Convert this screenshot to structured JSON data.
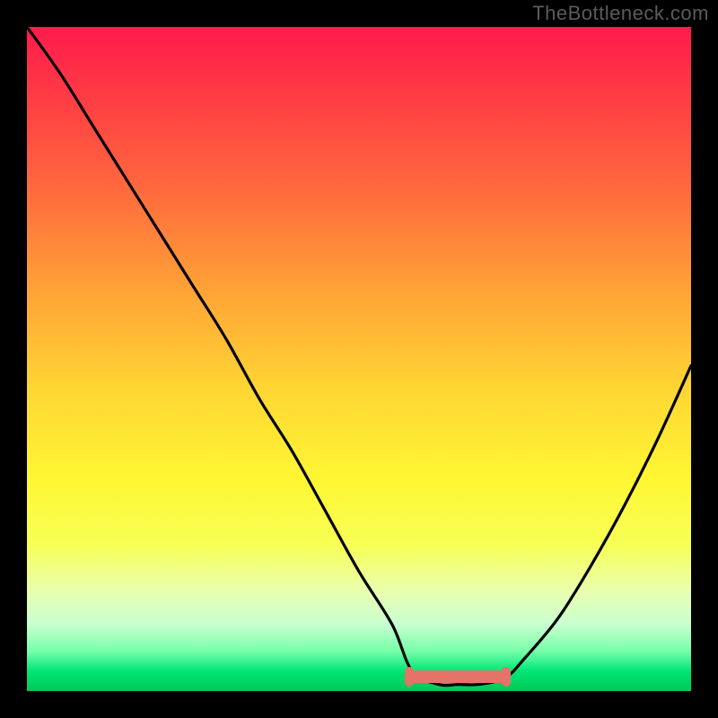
{
  "watermark": "TheBottleneck.com",
  "chart_data": {
    "type": "line",
    "title": "",
    "xlabel": "",
    "ylabel": "",
    "xlim": [
      0,
      100
    ],
    "ylim": [
      0,
      100
    ],
    "grid": false,
    "legend": false,
    "series": [
      {
        "name": "bottleneck-curve",
        "x": [
          0,
          5,
          10,
          15,
          20,
          25,
          30,
          35,
          40,
          45,
          50,
          55,
          58,
          62,
          65,
          68,
          72,
          75,
          80,
          85,
          90,
          95,
          100
        ],
        "values": [
          100,
          93,
          85,
          77,
          69,
          61,
          53,
          44,
          36,
          27,
          18,
          10,
          3,
          1,
          1,
          1,
          2,
          5,
          11,
          19,
          28,
          38,
          49
        ]
      }
    ],
    "optimal_range_x": [
      58,
      72
    ],
    "background_gradient": {
      "top": "#ff1a4d",
      "mid": "#ffd733",
      "bottom": "#00c853"
    }
  }
}
